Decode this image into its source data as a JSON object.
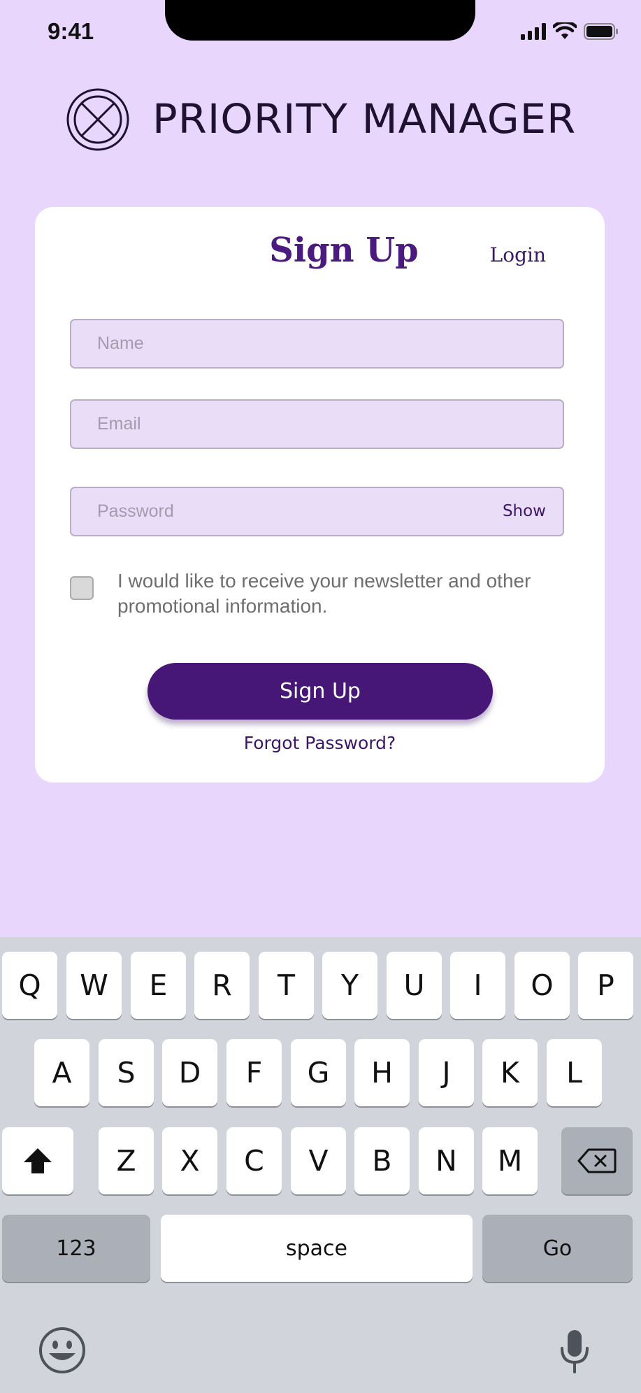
{
  "status": {
    "time": "9:41"
  },
  "header": {
    "title": "PRIORITY MANAGER"
  },
  "card": {
    "tab_signup": "Sign Up",
    "tab_login": "Login",
    "name_placeholder": "Name",
    "email_placeholder": "Email",
    "password_placeholder": "Password",
    "show_label": "Show",
    "consent_text": "I would like to receive your newsletter and other promotional information.",
    "consent_checked": false,
    "submit_label": "Sign Up",
    "forgot_label": "Forgot Password?"
  },
  "keyboard": {
    "row1": [
      "Q",
      "W",
      "E",
      "R",
      "T",
      "Y",
      "U",
      "I",
      "O",
      "P"
    ],
    "row2": [
      "A",
      "S",
      "D",
      "F",
      "G",
      "H",
      "J",
      "K",
      "L"
    ],
    "row3": [
      "Z",
      "X",
      "C",
      "V",
      "B",
      "N",
      "M"
    ],
    "numbers_label": "123",
    "space_label": "space",
    "go_label": "Go",
    "icons": [
      "shift-icon",
      "backspace-icon",
      "emoji-icon",
      "microphone-icon"
    ]
  },
  "colors": {
    "background": "#e8d6fd",
    "accent": "#471778",
    "field_bg": "#e9ddf7"
  }
}
